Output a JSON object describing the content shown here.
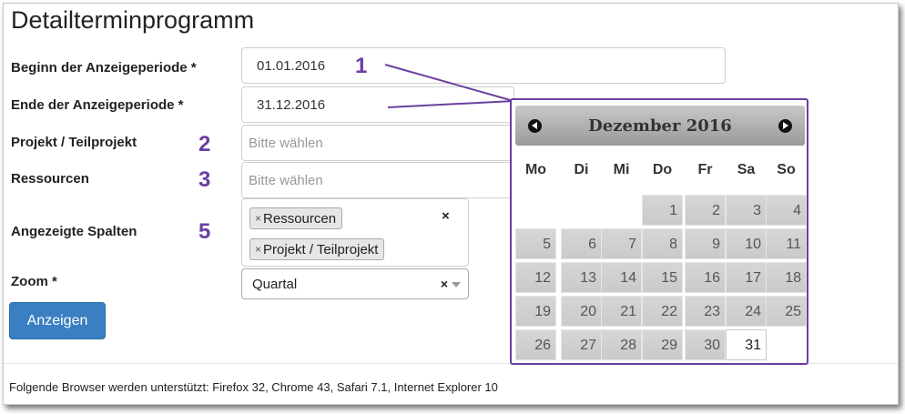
{
  "page_title": "Detailterminprogramm",
  "form": {
    "beginn": {
      "label": "Beginn der Anzeigeperiode *",
      "value": "01.01.2016",
      "marker": "1"
    },
    "ende": {
      "label": "Ende der Anzeigeperiode *",
      "value": "31.12.2016"
    },
    "projekt": {
      "label": "Projekt / Teilprojekt",
      "placeholder": "Bitte wählen",
      "marker": "2"
    },
    "ressourcen": {
      "label": "Ressourcen",
      "placeholder": "Bitte wählen",
      "marker": "3"
    },
    "spalten": {
      "label": "Angezeigte Spalten",
      "marker": "5",
      "chips": [
        "Ressourcen",
        "Projekt / Teilprojekt"
      ],
      "chip_remove": "×",
      "clear": "×"
    },
    "zoom": {
      "label": "Zoom *",
      "value": "Quartal",
      "clear": "×"
    },
    "submit": "Anzeigen"
  },
  "calendar": {
    "month_title": "Dezember 2016",
    "weekdays": [
      "Mo",
      "Di",
      "Mi",
      "Do",
      "Fr",
      "Sa",
      "So"
    ],
    "first_weekday_index": 3,
    "days_in_month": 31,
    "selected_day": 31,
    "accent_color": "#6b3fa0"
  },
  "footer": "Folgende Browser werden unterstützt: Firefox 32, Chrome 43, Safari 7.1, Internet Explorer 10"
}
